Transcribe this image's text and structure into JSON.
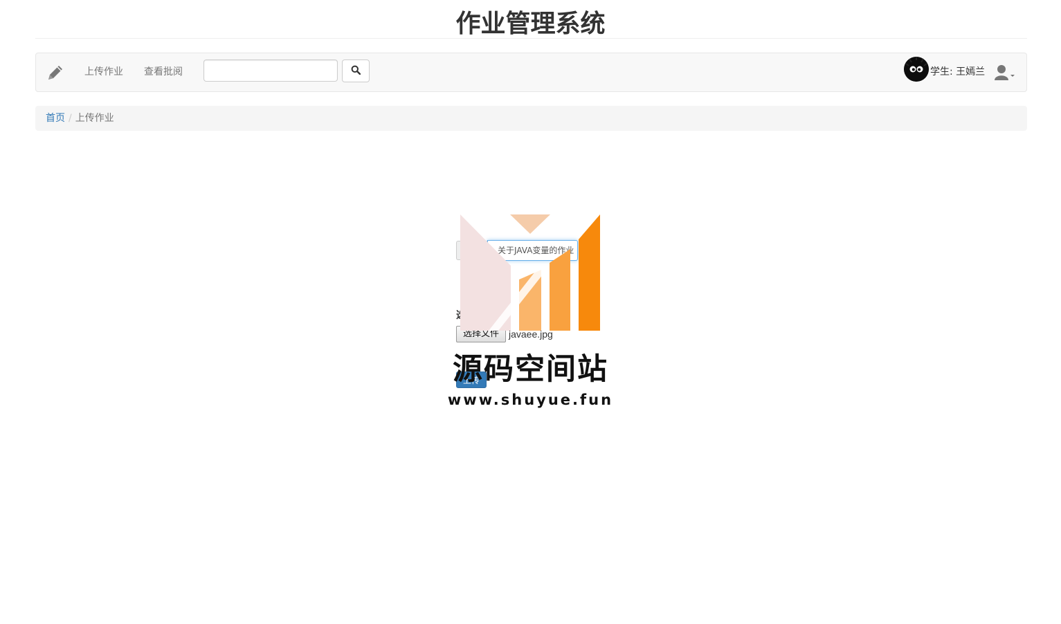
{
  "header": {
    "title": "作业管理系统"
  },
  "navbar": {
    "brand_icon": "pencil-icon",
    "links": [
      {
        "label": "上传作业"
      },
      {
        "label": "查看批阅"
      }
    ],
    "search": {
      "value": "",
      "placeholder": "",
      "button_icon": "search-icon"
    },
    "user": {
      "label": "学生: 王嫣兰",
      "avatar": "soot-sprite-avatar",
      "menu_icon": "user-icon"
    }
  },
  "breadcrumb": {
    "home": "首页",
    "separator": "/",
    "current": "上传作业"
  },
  "upload_form": {
    "title_value": "关于JAVA变量的作业",
    "file_label": "选择文件:",
    "file_button": "选择文件",
    "file_name": "javaee.jpg",
    "submit_label": "上传"
  },
  "watermark": {
    "name": "源码空间站",
    "url": "www.shuyue.fun"
  },
  "colors": {
    "primary": "#337ab7",
    "watermark_orange": "#f7890c",
    "navbar_bg": "#f8f8f8"
  }
}
